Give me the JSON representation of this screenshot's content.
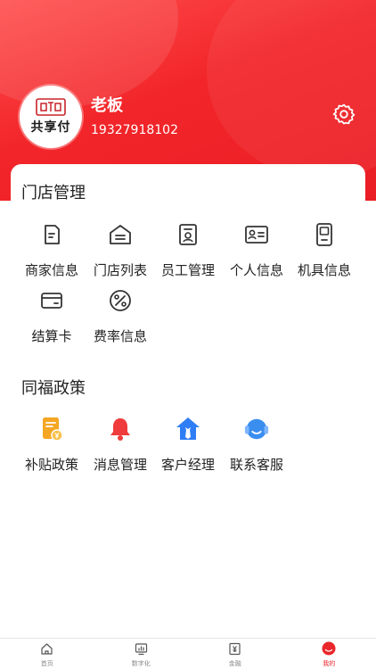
{
  "profile": {
    "logo_text": "共享付",
    "name": "老板",
    "phone": "19327918102"
  },
  "store_management": {
    "title": "门店管理",
    "items": [
      {
        "label": "商家信息",
        "icon": "document-icon"
      },
      {
        "label": "门店列表",
        "icon": "store-icon"
      },
      {
        "label": "员工管理",
        "icon": "staff-badge-icon"
      },
      {
        "label": "个人信息",
        "icon": "id-card-icon"
      },
      {
        "label": "机具信息",
        "icon": "pos-device-icon"
      },
      {
        "label": "结算卡",
        "icon": "bank-card-icon"
      },
      {
        "label": "费率信息",
        "icon": "percent-icon"
      }
    ]
  },
  "policy": {
    "title": "同福政策",
    "items": [
      {
        "label": "补贴政策",
        "icon": "subsidy-icon"
      },
      {
        "label": "消息管理",
        "icon": "bell-icon"
      },
      {
        "label": "客户经理",
        "icon": "manager-icon"
      },
      {
        "label": "联系客服",
        "icon": "headset-icon"
      }
    ]
  },
  "bottom_nav": [
    {
      "label": "首页",
      "icon": "home-icon"
    },
    {
      "label": "数字化",
      "icon": "chart-icon"
    },
    {
      "label": "金融",
      "icon": "yuan-icon"
    },
    {
      "label": "我的",
      "icon": "profile-icon",
      "active": true
    }
  ],
  "colors": {
    "accent": "#e9262a",
    "header": "#f2262a",
    "subsidy": "#f5a623",
    "bell": "#ef3b3b",
    "manager": "#2f7ef5",
    "service": "#3a8ef0"
  }
}
